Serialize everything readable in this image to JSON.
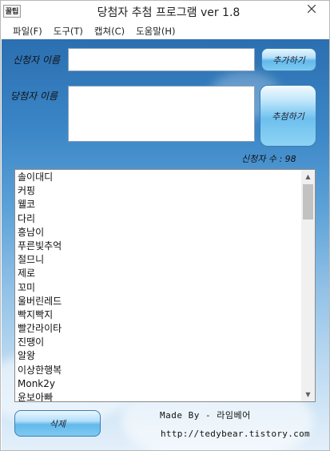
{
  "window": {
    "icon_text": "꿀팁",
    "title": "당첨자 추첨 프로그램 ver 1.8"
  },
  "menu": [
    "파일(F)",
    "도구(T)",
    "캡쳐(C)",
    "도움말(H)"
  ],
  "form": {
    "applicant_label": "신청자 이름",
    "applicant_value": "",
    "add_button": "추가하기",
    "winner_label": "당첨자 이름",
    "winner_value": "",
    "draw_button": "추첨하기",
    "count_label": "신청자 수 : 98"
  },
  "applicants": [
    "솔이대디",
    "커핑",
    "웰코",
    "다리",
    "흥남이",
    "푸른빛추억",
    "절므니",
    "제로",
    "꼬미",
    "울버린레드",
    "빡지빡지",
    "빨간라이타",
    "진땡이",
    "알왕",
    "이상한행복",
    "Monk2y",
    "윤보아빠"
  ],
  "footer": {
    "delete_button": "삭제",
    "made_by": "Made By - 라임베어",
    "url": "http://tedybear.tistory.com"
  }
}
